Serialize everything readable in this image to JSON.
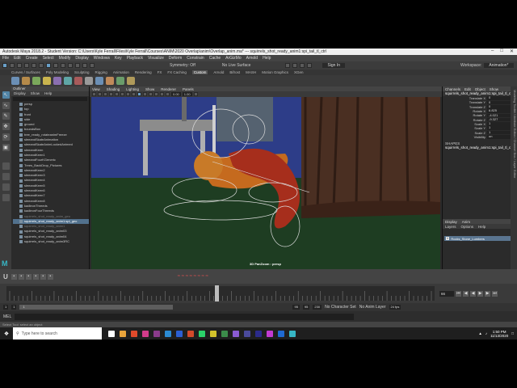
{
  "title": {
    "text": "Autodesk Maya 2018.2 - Student Version: C:\\Users\\Kyle Ferrall\\Files\\Kyle Ferrall\\Courses\\ANIM\\2020 Overlap\\anim\\Overlap_anim.ma* --- squirrels_shot_ready_anim1:spi_tail_tl_ctrl"
  },
  "menubar": [
    "File",
    "Edit",
    "Create",
    "Select",
    "Modify",
    "Display",
    "Windows",
    "Key",
    "Playback",
    "Visualize",
    "Deform",
    "Constrain",
    "Cache",
    "ArGizMo",
    "Arnold",
    "Help"
  ],
  "statusline": {
    "workspace_label": "Workspace:",
    "workspace_value": "Animation*",
    "symmetry": "Symmetry: Off",
    "live_surface": "No Live Surface",
    "sign_in": "Sign In"
  },
  "shelf_tabs": [
    "Curves / Surfaces",
    "Poly Modeling",
    "Sculpting",
    "Rigging",
    "Animation",
    "Rendering",
    "FX",
    "FX Caching",
    "Custom",
    "Arnold",
    "Bifrost",
    "MASH",
    "Motion Graphics",
    "XGen"
  ],
  "shelf_active": "Custom",
  "outliner": {
    "title": "Outliner",
    "menu": [
      "Display",
      "Show",
      "Help"
    ],
    "items": [
      {
        "label": "persp",
        "state": "normal"
      },
      {
        "label": "top",
        "state": "normal"
      },
      {
        "label": "front",
        "state": "normal"
      },
      {
        "label": "side",
        "state": "normal"
      },
      {
        "label": "ground",
        "state": "normal"
      },
      {
        "label": "boundsBox",
        "state": "normal"
      },
      {
        "label": "tree_ready_rotateanimFreeze",
        "state": "normal"
      },
      {
        "label": "sleeandSkateAnimation",
        "state": "normal"
      },
      {
        "label": "sleeandSkateAnimLockedAnimed",
        "state": "normal"
      },
      {
        "label": "sleeandKeen",
        "state": "normal"
      },
      {
        "label": "sleeandKeen1",
        "state": "normal"
      },
      {
        "label": "sleeandFourKGeneric",
        "state": "normal"
      },
      {
        "label": "Trees_BackDrop_Pictures",
        "state": "normal"
      },
      {
        "label": "sleeandKeen2",
        "state": "normal"
      },
      {
        "label": "sleeandKeen3",
        "state": "normal"
      },
      {
        "label": "sleeandKeen4",
        "state": "normal"
      },
      {
        "label": "sleeandKeen5",
        "state": "normal"
      },
      {
        "label": "sleeandKeen6",
        "state": "normal"
      },
      {
        "label": "sleeandKeen7",
        "state": "normal"
      },
      {
        "label": "sleeandKeen8",
        "state": "normal"
      },
      {
        "label": "kadleonThreeds",
        "state": "normal"
      },
      {
        "label": "kadleonFourThreeds",
        "state": "normal"
      },
      {
        "label": "squirrels_shot_ready_anim_geo",
        "state": "dim"
      },
      {
        "label": "squirrels_shot_ready_anim1:spi_geo",
        "state": "selected"
      },
      {
        "label": "squirrels_shot_ready_anim1",
        "state": "dim"
      },
      {
        "label": "squirrels_shot_ready_anim03",
        "state": "normal"
      },
      {
        "label": "squirrels_shot_ready_anim04",
        "state": "normal"
      },
      {
        "label": "squirrels_shot_ready_anim3RC",
        "state": "normal"
      }
    ]
  },
  "viewport": {
    "menu": [
      "View",
      "Shading",
      "Lighting",
      "Show",
      "Renderer",
      "Panels"
    ],
    "gamma": "0.00",
    "exposure": "1.00",
    "camera_label": "3D PanZoom : persp"
  },
  "channel_box": {
    "tabs": [
      "Channels",
      "Edit",
      "Object",
      "Show"
    ],
    "object_name": "squirrels_shot_ready_anim1:spi_tail_tl_ctrl",
    "attributes": [
      {
        "name": "Translate X",
        "value": "0"
      },
      {
        "name": "Translate Y",
        "value": "0"
      },
      {
        "name": "Translate Z",
        "value": "0"
      },
      {
        "name": "Rotate X",
        "value": "6.825"
      },
      {
        "name": "Rotate Y",
        "value": "-4.021"
      },
      {
        "name": "Rotate Z",
        "value": "-9.327"
      },
      {
        "name": "Scale X",
        "value": "1"
      },
      {
        "name": "Scale Y",
        "value": "1"
      },
      {
        "name": "Scale Z",
        "value": "1"
      },
      {
        "name": "Visibility",
        "value": "on"
      }
    ],
    "shapes_title": "SHAPES",
    "shapes_object": "squirrels_shot_ready_anim1:spi_tail_tl_ctrlShape"
  },
  "layer_editor": {
    "tabs": [
      "Display",
      "Anim"
    ],
    "menu": [
      "Layers",
      "Options",
      "Help"
    ],
    "row_label": "Rocks_Stone_Lumbers",
    "row_visible": "V"
  },
  "vertical_strip": "Modeling Toolkit / Attribute Editor / Channel Box / Layer Editor",
  "timeline": {
    "current_frame": "66",
    "fields_right": [
      "66"
    ]
  },
  "range": {
    "start": "1",
    "inner_start": "1",
    "slider_text": "1",
    "inner_end": "95",
    "end": "95",
    "end2": "230",
    "character_set": "No Character Set",
    "anim_layer": "No Anim Layer",
    "fps": "24 fps"
  },
  "mel": {
    "label": "MEL"
  },
  "help_line": [
    "Select Tool: select an object"
  ],
  "taskbar": {
    "search_placeholder": "Type here to search",
    "time": "1:50 PM",
    "date": "11/13/2020"
  }
}
